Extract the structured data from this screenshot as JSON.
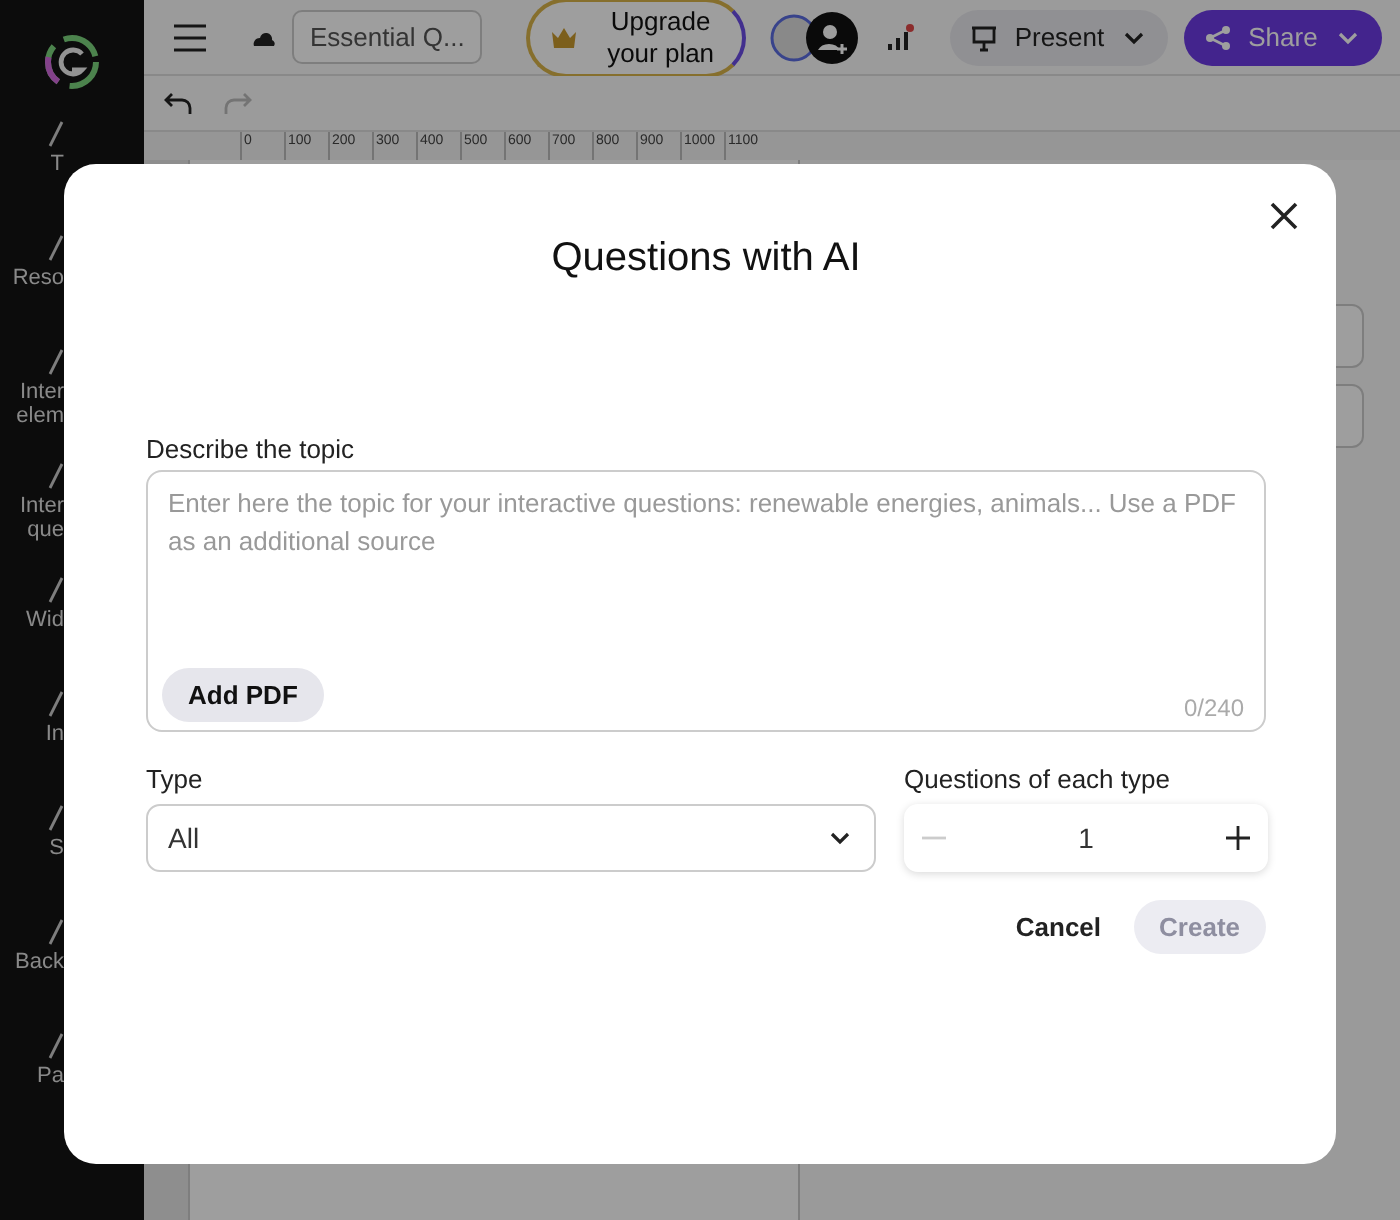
{
  "sidebar": {
    "items": [
      {
        "lines": [
          "T"
        ]
      },
      {
        "lines": [
          "Reso"
        ]
      },
      {
        "lines": [
          "Inter",
          "elem"
        ]
      },
      {
        "lines": [
          "Inter",
          "que"
        ]
      },
      {
        "lines": [
          "Wid"
        ]
      },
      {
        "lines": [
          "In"
        ]
      },
      {
        "lines": [
          "S"
        ]
      },
      {
        "lines": [
          "Back"
        ]
      },
      {
        "lines": [
          "Pa"
        ]
      }
    ]
  },
  "toolbar": {
    "document_title": "Essential Q...",
    "upgrade_button": "Upgrade your plan",
    "present_button": "Present",
    "share_button": "Share",
    "redo_disabled": true
  },
  "ruler": {
    "ticks": [
      "0",
      "100",
      "200",
      "300",
      "400",
      "500",
      "600",
      "700",
      "800",
      "900",
      "1000",
      "1100"
    ]
  },
  "dialog": {
    "title": "Questions with AI",
    "topic": {
      "label": "Describe the topic",
      "placeholder": "Enter here the topic for your interactive questions: renewable energies, animals... Use a PDF as an additional source",
      "add_pdf_button": "Add PDF",
      "counter": "0/240"
    },
    "type": {
      "label": "Type",
      "value": "All"
    },
    "count": {
      "label": "Questions of each type",
      "value": "1",
      "decrement_disabled": true
    },
    "buttons": [
      {
        "label": "Cancel",
        "kind": "text",
        "disabled": false
      },
      {
        "label": "Create",
        "kind": "primary",
        "disabled": true
      }
    ]
  }
}
